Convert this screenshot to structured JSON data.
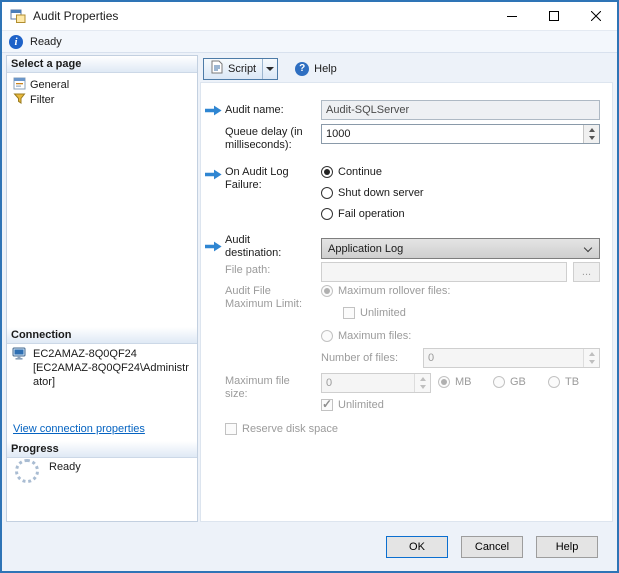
{
  "window": {
    "title": "Audit Properties"
  },
  "statusbar": {
    "status": "Ready"
  },
  "colors": {
    "accent_blue": "#2e74b6",
    "arrow_blue": "#2f86d2",
    "link_blue": "#0563c1"
  },
  "sidebar": {
    "select_page_header": "Select a page",
    "pages": [
      {
        "label": "General"
      },
      {
        "label": "Filter"
      }
    ],
    "connection_header": "Connection",
    "connection": {
      "server": "EC2AMAZ-8Q0QF24",
      "account": "[EC2AMAZ-8Q0QF24\\Administrator]"
    },
    "view_connection_link": "View connection properties",
    "progress_header": "Progress",
    "progress_status": "Ready"
  },
  "toolbar": {
    "script": "Script",
    "help": "Help"
  },
  "form": {
    "audit_name": {
      "label": "Audit name:",
      "value": "Audit-SQLServer"
    },
    "queue_delay": {
      "label": "Queue delay (in milliseconds):",
      "value": "1000"
    },
    "on_audit_log_failure": {
      "label": "On Audit Log Failure:",
      "options": [
        "Continue",
        "Shut down server",
        "Fail operation"
      ],
      "selected": "Continue"
    },
    "audit_destination": {
      "label": "Audit destination:",
      "value": "Application Log"
    },
    "file_path": {
      "label": "File path:",
      "value": "",
      "browse": "..."
    },
    "audit_file_maximum_limit": {
      "label": "Audit File Maximum Limit:",
      "maximum_rollover_files": "Maximum rollover files:",
      "unlimited": "Unlimited",
      "maximum_files": "Maximum files:",
      "number_of_files_label": "Number of files:",
      "number_of_files_value": "0",
      "selected": "Maximum rollover files:"
    },
    "maximum_file_size": {
      "label": "Maximum file size:",
      "value": "0",
      "units": [
        "MB",
        "GB",
        "TB"
      ],
      "selected_unit": "MB",
      "unlimited": "Unlimited",
      "unlimited_checked": true
    },
    "reserve_disk_space": "Reserve disk space"
  },
  "footer": {
    "ok": "OK",
    "cancel": "Cancel",
    "help": "Help"
  }
}
